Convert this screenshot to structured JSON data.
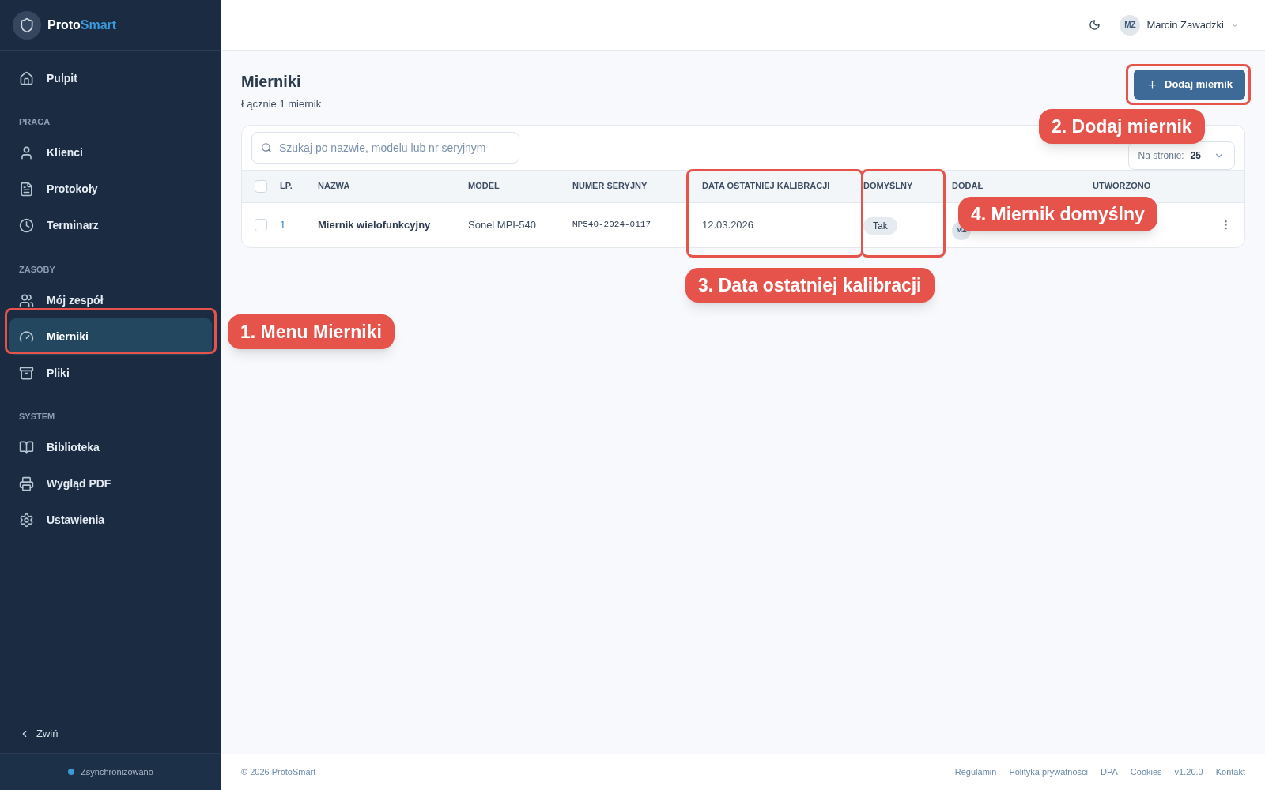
{
  "brand": {
    "part1": "Proto",
    "part2": "Smart"
  },
  "sidebar": {
    "items": [
      {
        "kind": "item",
        "label": "Pulpit",
        "selected": false
      },
      {
        "kind": "section",
        "label": "PRACA"
      },
      {
        "kind": "item",
        "label": "Klienci",
        "selected": false
      },
      {
        "kind": "item",
        "label": "Protokoły",
        "selected": false
      },
      {
        "kind": "item",
        "label": "Terminarz",
        "selected": false
      },
      {
        "kind": "section",
        "label": "ZASOBY"
      },
      {
        "kind": "item",
        "label": "Mój zespół",
        "selected": false
      },
      {
        "kind": "item",
        "label": "Mierniki",
        "selected": true
      },
      {
        "kind": "item",
        "label": "Pliki",
        "selected": false
      },
      {
        "kind": "section",
        "label": "SYSTEM"
      },
      {
        "kind": "item",
        "label": "Biblioteka",
        "selected": false
      },
      {
        "kind": "item",
        "label": "Wygląd PDF",
        "selected": false
      },
      {
        "kind": "item",
        "label": "Ustawienia",
        "selected": false
      }
    ],
    "collapse": "Zwiń",
    "sync": "Zsynchronizowano"
  },
  "topbar": {
    "user_initials": "MZ",
    "user_name": "Marcin Zawadzki"
  },
  "page": {
    "title": "Mierniki",
    "subtitle": "Łącznie 1 miernik",
    "add_button": "Dodaj miernik"
  },
  "search": {
    "placeholder": "Szukaj po nazwie, modelu lub nr seryjnym"
  },
  "per_page": {
    "label": "Na stronie:",
    "value": "25"
  },
  "table": {
    "all_checked": false,
    "columns": [
      "LP.",
      "NAZWA",
      "MODEL",
      "NUMER SERYJNY",
      "DATA OSTATNIEJ KALIBRACJI",
      "DOMYŚLNY",
      "DODAŁ",
      "UTWORZONO"
    ],
    "rows": [
      {
        "checked": false,
        "lp": "1",
        "name": "Miernik wielofunkcyjny",
        "model": "Sonel MPI-540",
        "serial": "MP540-2024-0117",
        "calibration": "12.03.2026",
        "default": "Tak",
        "added_by_initials": "MZ"
      }
    ]
  },
  "footer": {
    "copyright": "© 2026 ProtoSmart",
    "links": [
      "Regulamin",
      "Polityka prywatności",
      "DPA",
      "Cookies",
      "v1.20.0",
      "Kontakt"
    ]
  },
  "annotations": [
    {
      "label": "1. Menu Mierniki"
    },
    {
      "label": "2. Dodaj miernik"
    },
    {
      "label": "3. Data ostatniej kalibracji"
    },
    {
      "label": "4. Miernik domyślny"
    }
  ]
}
